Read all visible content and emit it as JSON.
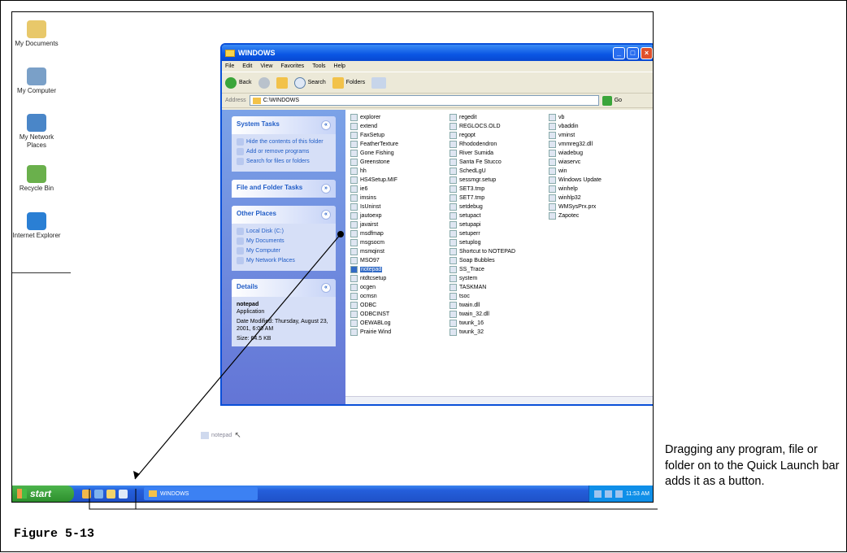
{
  "desktop": {
    "icons": [
      {
        "label": "My Documents",
        "icon": "folder-documents-icon",
        "color": "#e8c86a"
      },
      {
        "label": "My Computer",
        "icon": "computer-icon",
        "color": "#7aa0c8"
      },
      {
        "label": "My Network Places",
        "icon": "network-icon",
        "color": "#4a86c8"
      },
      {
        "label": "Recycle Bin",
        "icon": "recycle-bin-icon",
        "color": "#6ab04c"
      },
      {
        "label": "Internet Explorer",
        "icon": "internet-explorer-icon",
        "color": "#2a7fd4"
      }
    ]
  },
  "window": {
    "title": "WINDOWS",
    "menu": [
      "File",
      "Edit",
      "View",
      "Favorites",
      "Tools",
      "Help"
    ],
    "toolbar": {
      "back": "Back",
      "search": "Search",
      "folders": "Folders"
    },
    "address_label": "Address",
    "address_value": "C:\\WINDOWS",
    "go": "Go",
    "left_panels": {
      "system_tasks": {
        "title": "System Tasks",
        "items": [
          "Hide the contents of this folder",
          "Add or remove programs",
          "Search for files or folders"
        ]
      },
      "file_folder_tasks": {
        "title": "File and Folder Tasks"
      },
      "other_places": {
        "title": "Other Places",
        "items": [
          "Local Disk (C:)",
          "My Documents",
          "My Computer",
          "My Network Places"
        ]
      },
      "details": {
        "title": "Details",
        "name": "notepad",
        "type": "Application",
        "modified": "Date Modified: Thursday, August 23, 2001, 6:00 AM",
        "size": "Size: 64.5 KB"
      }
    },
    "files": [
      [
        "explorer",
        "extend",
        "FaxSetup",
        "FeatherTexture",
        "Gone Fishing",
        "Greenstone",
        "hh",
        "HS4Setup.MIF",
        "ie6",
        "imsins",
        "IsUninst",
        "jautoexp",
        "javairst",
        "msdfmap",
        "msgsocm",
        "msmqinst",
        "MSO97",
        "notepad",
        "ntdtcsetup",
        "ocgen",
        "ocmsn",
        "ODBC",
        "ODBCINST",
        "OEWABLog",
        "Prairie Wind"
      ],
      [
        "regedit",
        "REGLOCS.OLD",
        "regopt",
        "Rhododendron",
        "River Sumida",
        "Santa Fe Stucco",
        "SchedLgU",
        "sessmgr.setup",
        "SET3.tmp",
        "SET7.tmp",
        "setdebug",
        "setupact",
        "setupapi",
        "setuperr",
        "setuplog",
        "Shortcut to NOTEPAD",
        "Soap Bubbles",
        "SS_Trace",
        "system",
        "TASKMAN",
        "tsoc",
        "twain.dll",
        "twain_32.dll",
        "twunk_16",
        "twunk_32"
      ],
      [
        "vb",
        "vbaddin",
        "vminst",
        "vmmreg32.dll",
        "wiadebug",
        "wiaservc",
        "win",
        "Windows Update",
        "winhelp",
        "winhlp32",
        "WMSysPrx.prx",
        "Zapotec"
      ]
    ],
    "selected_file": "notepad"
  },
  "drag_ghost": "notepad",
  "taskbar": {
    "start": "start",
    "task_button": "WINDOWS",
    "clock": "11:53 AM",
    "quick_launch_colors": [
      "#f2b84b",
      "#7fb3ee",
      "#f3d36a",
      "#dfe9f7"
    ]
  },
  "caption": "Dragging any program, file or folder on to the Quick Launch bar adds it as a button.",
  "figure_label": "Figure 5-13"
}
